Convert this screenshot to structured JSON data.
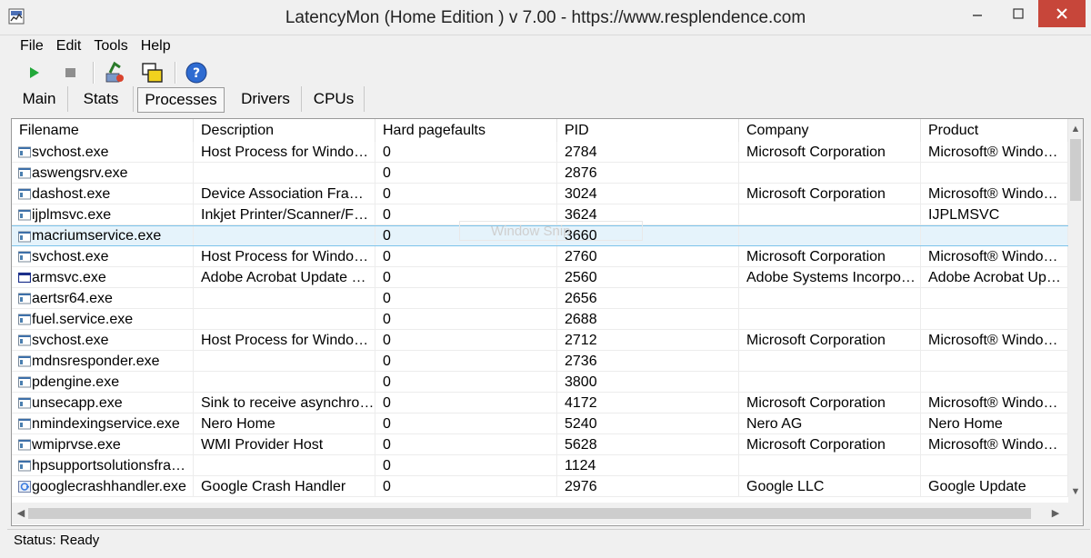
{
  "window": {
    "title": "LatencyMon  (Home Edition )  v 7.00 - https://www.resplendence.com",
    "minimize_glyph": "–",
    "maximize_glyph": "☐",
    "close_glyph": "✕"
  },
  "menu": {
    "file": "File",
    "edit": "Edit",
    "tools": "Tools",
    "help": "Help"
  },
  "toolbar": {
    "icons": [
      "play-icon",
      "stop-icon",
      "submit-icon",
      "windows-icon",
      "help-icon"
    ]
  },
  "tabs": [
    {
      "label": "Main",
      "active": false
    },
    {
      "label": "Stats",
      "active": false
    },
    {
      "label": "Processes",
      "active": true
    },
    {
      "label": "Drivers",
      "active": false
    },
    {
      "label": "CPUs",
      "active": false
    }
  ],
  "table": {
    "columns": [
      "Filename",
      "Description",
      "Hard pagefaults",
      "PID",
      "Company",
      "Product"
    ],
    "rows": [
      [
        "svchost.exe",
        "Host Process for Windows Services",
        "0",
        "2784",
        "Microsoft Corporation",
        "Microsoft® Windows® Operating System"
      ],
      [
        "aswengsrv.exe",
        "",
        "0",
        "2876",
        "",
        ""
      ],
      [
        "dashost.exe",
        "Device Association Framework Provider Host",
        "0",
        "3024",
        "Microsoft Corporation",
        "Microsoft® Windows® Operating System"
      ],
      [
        "ijplmsvc.exe",
        "Inkjet Printer/Scanner/Fax Extended Survey Program",
        "0",
        "3624",
        "",
        "IJPLMSVC"
      ],
      [
        "macriumservice.exe",
        "",
        "0",
        "3660",
        "",
        ""
      ],
      [
        "svchost.exe",
        "Host Process for Windows Services",
        "0",
        "2760",
        "Microsoft Corporation",
        "Microsoft® Windows® Operating System"
      ],
      [
        "armsvc.exe",
        "Adobe Acrobat Update Service",
        "0",
        "2560",
        "Adobe Systems Incorporated",
        "Adobe Acrobat Update Service"
      ],
      [
        "aertsr64.exe",
        "",
        "0",
        "2656",
        "",
        ""
      ],
      [
        "fuel.service.exe",
        "",
        "0",
        "2688",
        "",
        ""
      ],
      [
        "svchost.exe",
        "Host Process for Windows Services",
        "0",
        "2712",
        "Microsoft Corporation",
        "Microsoft® Windows® Operating System"
      ],
      [
        "mdnsresponder.exe",
        "",
        "0",
        "2736",
        "",
        ""
      ],
      [
        "pdengine.exe",
        "",
        "0",
        "3800",
        "",
        ""
      ],
      [
        "unsecapp.exe",
        "Sink to receive asynchronous callbacks for WMI client application",
        "0",
        "4172",
        "Microsoft Corporation",
        "Microsoft® Windows® Operating System"
      ],
      [
        "nmindexingservice.exe",
        "Nero Home",
        "0",
        "5240",
        "Nero AG",
        "Nero Home"
      ],
      [
        "wmiprvse.exe",
        "WMI Provider Host",
        "0",
        "5628",
        "Microsoft Corporation",
        "Microsoft® Windows® Operating System"
      ],
      [
        "hpsupportsolutionsframeworkservice.exe",
        "",
        "0",
        "1124",
        "",
        ""
      ],
      [
        "googlecrashhandler.exe",
        "Google Crash Handler",
        "0",
        "2976",
        "Google LLC",
        "Google Update"
      ]
    ],
    "selected_row": 4,
    "row_icons": [
      "exe-icon",
      "exe-icon",
      "exe-icon",
      "exe-icon",
      "exe-icon",
      "exe-icon",
      "window-icon",
      "exe-icon",
      "exe-icon",
      "exe-icon",
      "exe-icon",
      "exe-icon",
      "exe-icon",
      "exe-icon",
      "exe-icon",
      "exe-icon",
      "google-icon"
    ]
  },
  "ghost_overlay": "Window Snip",
  "status": "Status: Ready",
  "colors": {
    "selected_row": "#e5f3fb",
    "close_button": "#c7463a"
  }
}
